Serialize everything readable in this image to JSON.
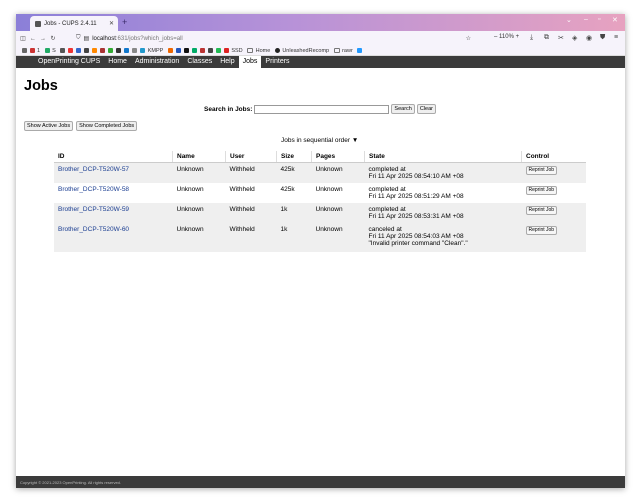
{
  "browser": {
    "tab_title": "Jobs - CUPS 2.4.11",
    "url_host": "localhost",
    "url_path": ":631/jobs?which_jobs=all",
    "zoom": "110%",
    "bookmarks": [
      "1",
      "S",
      "KMPP",
      "SSD",
      "Home",
      "UnleashedRecomp",
      "rawr"
    ]
  },
  "nav": {
    "items": [
      "OpenPrinting CUPS",
      "Home",
      "Administration",
      "Classes",
      "Help",
      "Jobs",
      "Printers"
    ],
    "active": "Jobs"
  },
  "page": {
    "title": "Jobs",
    "search_label": "Search in Jobs:",
    "search_button": "Search",
    "clear_button": "Clear",
    "show_active": "Show Active Jobs",
    "show_completed": "Show Completed Jobs",
    "order_text": "Jobs in sequential order ▼"
  },
  "table": {
    "headers": [
      "ID",
      "Name",
      "User",
      "Size",
      "Pages",
      "State",
      "Control"
    ],
    "rows": [
      {
        "id": "Brother_DCP-T520W-57",
        "name": "Unknown",
        "user": "Withheld",
        "size": "425k",
        "pages": "Unknown",
        "state": "completed at",
        "time": "Fri 11 Apr 2025 08:54:10 AM +08",
        "reason": "",
        "control": "Reprint Job"
      },
      {
        "id": "Brother_DCP-T520W-58",
        "name": "Unknown",
        "user": "Withheld",
        "size": "425k",
        "pages": "Unknown",
        "state": "completed at",
        "time": "Fri 11 Apr 2025 08:51:29 AM +08",
        "reason": "",
        "control": "Reprint Job"
      },
      {
        "id": "Brother_DCP-T520W-59",
        "name": "Unknown",
        "user": "Withheld",
        "size": "1k",
        "pages": "Unknown",
        "state": "completed at",
        "time": "Fri 11 Apr 2025 08:53:31 AM +08",
        "reason": "",
        "control": "Reprint Job"
      },
      {
        "id": "Brother_DCP-T520W-60",
        "name": "Unknown",
        "user": "Withheld",
        "size": "1k",
        "pages": "Unknown",
        "state": "canceled at",
        "time": "Fri 11 Apr 2025 08:54:03 AM +08",
        "reason": "\"Invalid printer command \"Clean\".\"",
        "control": "Reprint Job"
      }
    ]
  },
  "footer": "Copyright © 2021-2023 OpenPrinting. All rights reserved."
}
